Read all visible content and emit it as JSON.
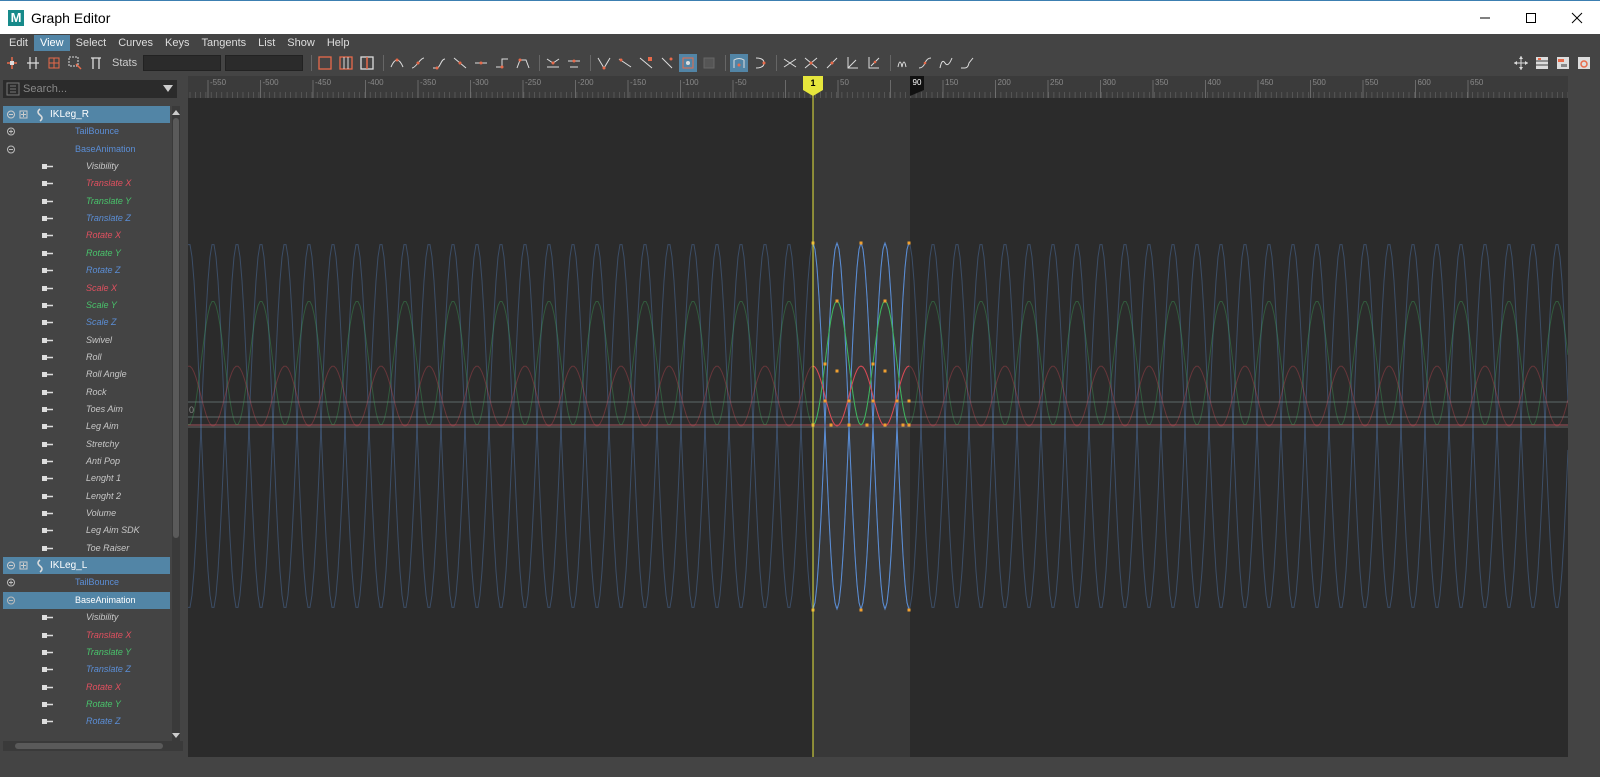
{
  "window": {
    "title": "Graph Editor",
    "app_icon_letter": "M"
  },
  "menu": [
    "Edit",
    "View",
    "Select",
    "Curves",
    "Keys",
    "Tangents",
    "List",
    "Show",
    "Help"
  ],
  "menu_active_index": 1,
  "toolbar": {
    "stats_label": "Stats"
  },
  "search": {
    "placeholder": "Search..."
  },
  "outliner": [
    {
      "kind": "node",
      "label": "IKLeg_R"
    },
    {
      "kind": "layer",
      "label": "TailBounce",
      "expander": "plus"
    },
    {
      "kind": "layer",
      "label": "BaseAnimation",
      "expander": "minus"
    },
    {
      "kind": "attr",
      "label": "Visibility",
      "color": "#c8c8c8"
    },
    {
      "kind": "attr",
      "label": "Translate X",
      "color": "#e0505f"
    },
    {
      "kind": "attr",
      "label": "Translate Y",
      "color": "#49c36b"
    },
    {
      "kind": "attr",
      "label": "Translate Z",
      "color": "#5b8ed6"
    },
    {
      "kind": "attr",
      "label": "Rotate X",
      "color": "#e0505f"
    },
    {
      "kind": "attr",
      "label": "Rotate Y",
      "color": "#49c36b"
    },
    {
      "kind": "attr",
      "label": "Rotate Z",
      "color": "#5b8ed6"
    },
    {
      "kind": "attr",
      "label": "Scale X",
      "color": "#e0505f"
    },
    {
      "kind": "attr",
      "label": "Scale Y",
      "color": "#49c36b"
    },
    {
      "kind": "attr",
      "label": "Scale Z",
      "color": "#5b8ed6"
    },
    {
      "kind": "attr",
      "label": "Swivel",
      "color": "#c8c8c8"
    },
    {
      "kind": "attr",
      "label": "Roll",
      "color": "#c8c8c8"
    },
    {
      "kind": "attr",
      "label": "Roll Angle",
      "color": "#c8c8c8"
    },
    {
      "kind": "attr",
      "label": "Rock",
      "color": "#c8c8c8"
    },
    {
      "kind": "attr",
      "label": "Toes Aim",
      "color": "#c8c8c8"
    },
    {
      "kind": "attr",
      "label": "Leg Aim",
      "color": "#c8c8c8"
    },
    {
      "kind": "attr",
      "label": "Stretchy",
      "color": "#c8c8c8"
    },
    {
      "kind": "attr",
      "label": "Anti Pop",
      "color": "#c8c8c8"
    },
    {
      "kind": "attr",
      "label": "Lenght 1",
      "color": "#c8c8c8"
    },
    {
      "kind": "attr",
      "label": "Lenght 2",
      "color": "#c8c8c8"
    },
    {
      "kind": "attr",
      "label": "Volume",
      "color": "#c8c8c8"
    },
    {
      "kind": "attr",
      "label": "Leg Aim SDK",
      "color": "#c8c8c8"
    },
    {
      "kind": "attr",
      "label": "Toe Raiser",
      "color": "#c8c8c8"
    },
    {
      "kind": "node",
      "label": "IKLeg_L"
    },
    {
      "kind": "layer",
      "label": "TailBounce",
      "expander": "plus"
    },
    {
      "kind": "layer-sel",
      "label": "BaseAnimation",
      "expander": "minus"
    },
    {
      "kind": "attr",
      "label": "Visibility",
      "color": "#c8c8c8"
    },
    {
      "kind": "attr",
      "label": "Translate X",
      "color": "#e0505f"
    },
    {
      "kind": "attr",
      "label": "Translate Y",
      "color": "#49c36b"
    },
    {
      "kind": "attr",
      "label": "Translate Z",
      "color": "#5b8ed6"
    },
    {
      "kind": "attr",
      "label": "Rotate X",
      "color": "#e0505f"
    },
    {
      "kind": "attr",
      "label": "Rotate Y",
      "color": "#49c36b"
    },
    {
      "kind": "attr",
      "label": "Rotate Z",
      "color": "#5b8ed6"
    }
  ],
  "timeline": {
    "ticks": [
      "-550",
      "-500",
      "-450",
      "-400",
      "-350",
      "-300",
      "-250",
      "-200",
      "-150",
      "-100",
      "-50",
      "",
      "50",
      "",
      "150",
      "200",
      "250",
      "300",
      "350",
      "400",
      "450",
      "500",
      "550",
      "600",
      "650"
    ],
    "current_frame": "1",
    "end_frame": "90",
    "zero_label": "0"
  },
  "colors": {
    "accent": "#5285a6",
    "curve_x": "#d84a55",
    "curve_y": "#3fb35e",
    "curve_z": "#5b8ed6",
    "key": "#f0a030",
    "playhead": "#e6e63c"
  }
}
